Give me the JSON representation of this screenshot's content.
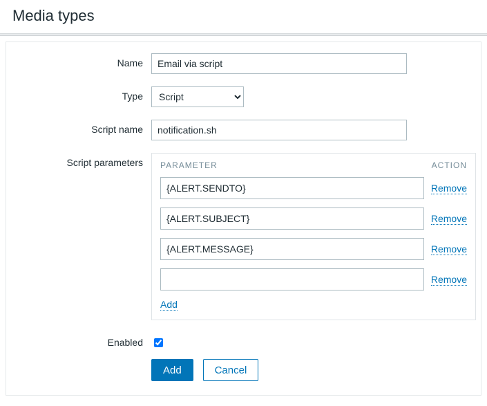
{
  "page": {
    "title": "Media types"
  },
  "labels": {
    "name": "Name",
    "type": "Type",
    "script_name": "Script name",
    "script_parameters": "Script parameters",
    "enabled": "Enabled"
  },
  "fields": {
    "name_value": "Email via script",
    "type_selected": "Script",
    "script_name_value": "notification.sh",
    "enabled_checked": true
  },
  "params_table": {
    "col_parameter": "PARAMETER",
    "col_action": "ACTION",
    "rows": [
      {
        "value": "{ALERT.SENDTO}",
        "remove": "Remove"
      },
      {
        "value": "{ALERT.SUBJECT}",
        "remove": "Remove"
      },
      {
        "value": "{ALERT.MESSAGE}",
        "remove": "Remove"
      },
      {
        "value": "",
        "remove": "Remove"
      }
    ],
    "add_label": "Add"
  },
  "buttons": {
    "add": "Add",
    "cancel": "Cancel"
  }
}
